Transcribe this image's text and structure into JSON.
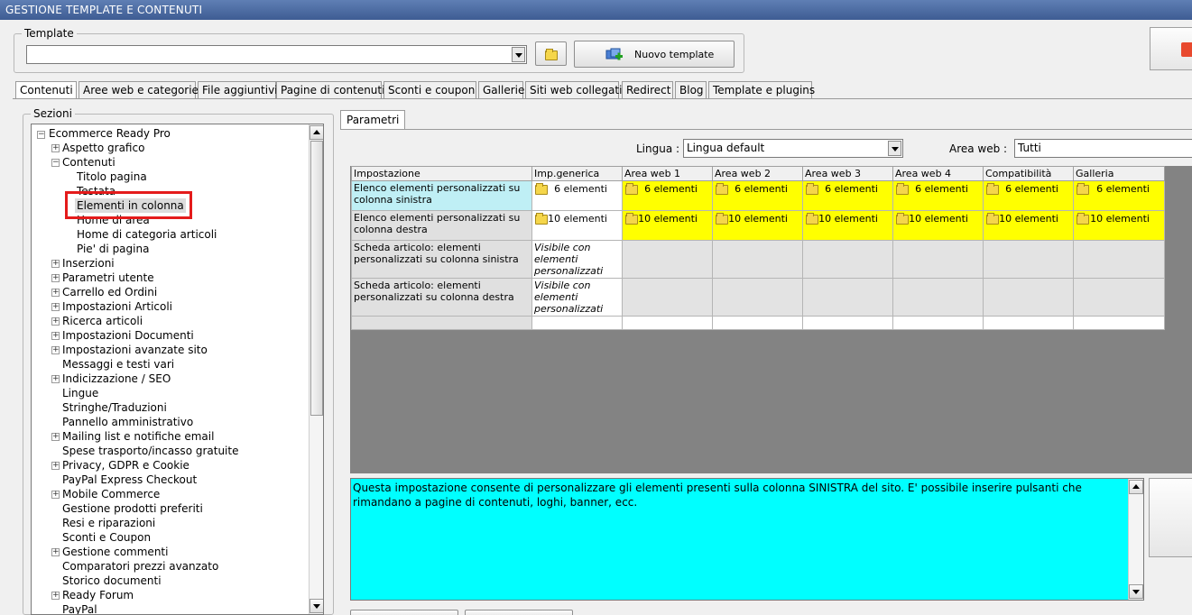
{
  "window": {
    "title": "GESTIONE TEMPLATE E CONTENUTI"
  },
  "template_group": {
    "legend": "Template",
    "selected_value": "",
    "new_template_label": "Nuovo template"
  },
  "tabs": [
    {
      "label": "Contenuti",
      "active": true
    },
    {
      "label": "Aree web e categorie"
    },
    {
      "label": "File aggiuntivi"
    },
    {
      "label": "Pagine di contenuti"
    },
    {
      "label": "Sconti e coupon"
    },
    {
      "label": "Gallerie"
    },
    {
      "label": "Siti web collegati"
    },
    {
      "label": "Redirect"
    },
    {
      "label": "Blog"
    },
    {
      "label": "Template e plugins"
    }
  ],
  "sections": {
    "legend": "Sezioni",
    "root": "Ecommerce Ready Pro",
    "items": [
      {
        "label": "Aspetto grafico",
        "level": 1,
        "expander": "+"
      },
      {
        "label": "Contenuti",
        "level": 1,
        "expander": "-"
      },
      {
        "label": "Titolo pagina",
        "level": 2
      },
      {
        "label": "Testata",
        "level": 2
      },
      {
        "label": "Elementi in colonna",
        "level": 2,
        "selected": true
      },
      {
        "label": "Home di area",
        "level": 2
      },
      {
        "label": "Home di categoria articoli",
        "level": 2
      },
      {
        "label": "Pie' di pagina",
        "level": 2
      },
      {
        "label": "Inserzioni",
        "level": 1,
        "expander": "+"
      },
      {
        "label": "Parametri utente",
        "level": 1,
        "expander": "+"
      },
      {
        "label": "Carrello ed Ordini",
        "level": 1,
        "expander": "+"
      },
      {
        "label": "Impostazioni Articoli",
        "level": 1,
        "expander": "+"
      },
      {
        "label": "Ricerca articoli",
        "level": 1,
        "expander": "+"
      },
      {
        "label": "Impostazioni Documenti",
        "level": 1,
        "expander": "+"
      },
      {
        "label": "Impostazioni avanzate sito",
        "level": 1,
        "expander": "+"
      },
      {
        "label": "Messaggi e testi vari",
        "level": 1
      },
      {
        "label": "Indicizzazione / SEO",
        "level": 1,
        "expander": "+"
      },
      {
        "label": "Lingue",
        "level": 1
      },
      {
        "label": "Stringhe/Traduzioni",
        "level": 1
      },
      {
        "label": "Pannello amministrativo",
        "level": 1
      },
      {
        "label": "Mailing list e notifiche email",
        "level": 1,
        "expander": "+"
      },
      {
        "label": "Spese trasporto/incasso gratuite",
        "level": 1
      },
      {
        "label": "Privacy, GDPR e Cookie",
        "level": 1,
        "expander": "+"
      },
      {
        "label": "PayPal Express Checkout",
        "level": 1
      },
      {
        "label": "Mobile Commerce",
        "level": 1,
        "expander": "+"
      },
      {
        "label": "Gestione prodotti preferiti",
        "level": 1
      },
      {
        "label": "Resi e riparazioni",
        "level": 1
      },
      {
        "label": "Sconti e Coupon",
        "level": 1
      },
      {
        "label": "Gestione commenti",
        "level": 1,
        "expander": "+"
      },
      {
        "label": "Comparatori prezzi avanzato",
        "level": 1
      },
      {
        "label": "Storico documenti",
        "level": 1
      },
      {
        "label": "Ready Forum",
        "level": 1,
        "expander": "+"
      },
      {
        "label": "PayPal",
        "level": 1
      }
    ]
  },
  "parametri": {
    "tab_label": "Parametri",
    "lingua_label": "Lingua :",
    "lingua_value": "Lingua default",
    "area_web_label": "Area web :",
    "area_web_value": "Tutti",
    "columns": [
      "Impostazione",
      "Imp.generica",
      "Area web 1",
      "Area web 2",
      "Area web 3",
      "Area web 4",
      "Compatibilità",
      "Galleria"
    ],
    "rows": [
      {
        "label": "Elenco elementi personalizzati su colonna sinistra",
        "generic": "6 elementi",
        "areas": [
          "6 elementi",
          "6 elementi",
          "6 elementi",
          "6 elementi",
          "6 elementi",
          "6 elementi"
        ]
      },
      {
        "label": "Elenco elementi personalizzati su colonna destra",
        "generic": "10 elementi",
        "areas": [
          "10 elementi",
          "10 elementi",
          "10 elementi",
          "10 elementi",
          "10 elementi",
          "10 elementi"
        ]
      },
      {
        "label": "Scheda articolo: elementi personalizzati su colonna sinistra",
        "generic": "Visibile con elementi personalizzati"
      },
      {
        "label": "Scheda articolo: elementi personalizzati su colonna destra",
        "generic": "Visibile con elementi personalizzati"
      }
    ]
  },
  "description": "Questa impostazione consente di personalizzare gli elementi presenti sulla colonna SINISTRA del sito. E' possibile inserire pulsanti che rimandano a pagine di contenuti, loghi, banner, ecc.",
  "colors": {
    "selected_row": "#bfeff5",
    "override_cell": "#ffff00",
    "description_bg": "#00ffff",
    "highlight_box": "#e41b1b"
  }
}
